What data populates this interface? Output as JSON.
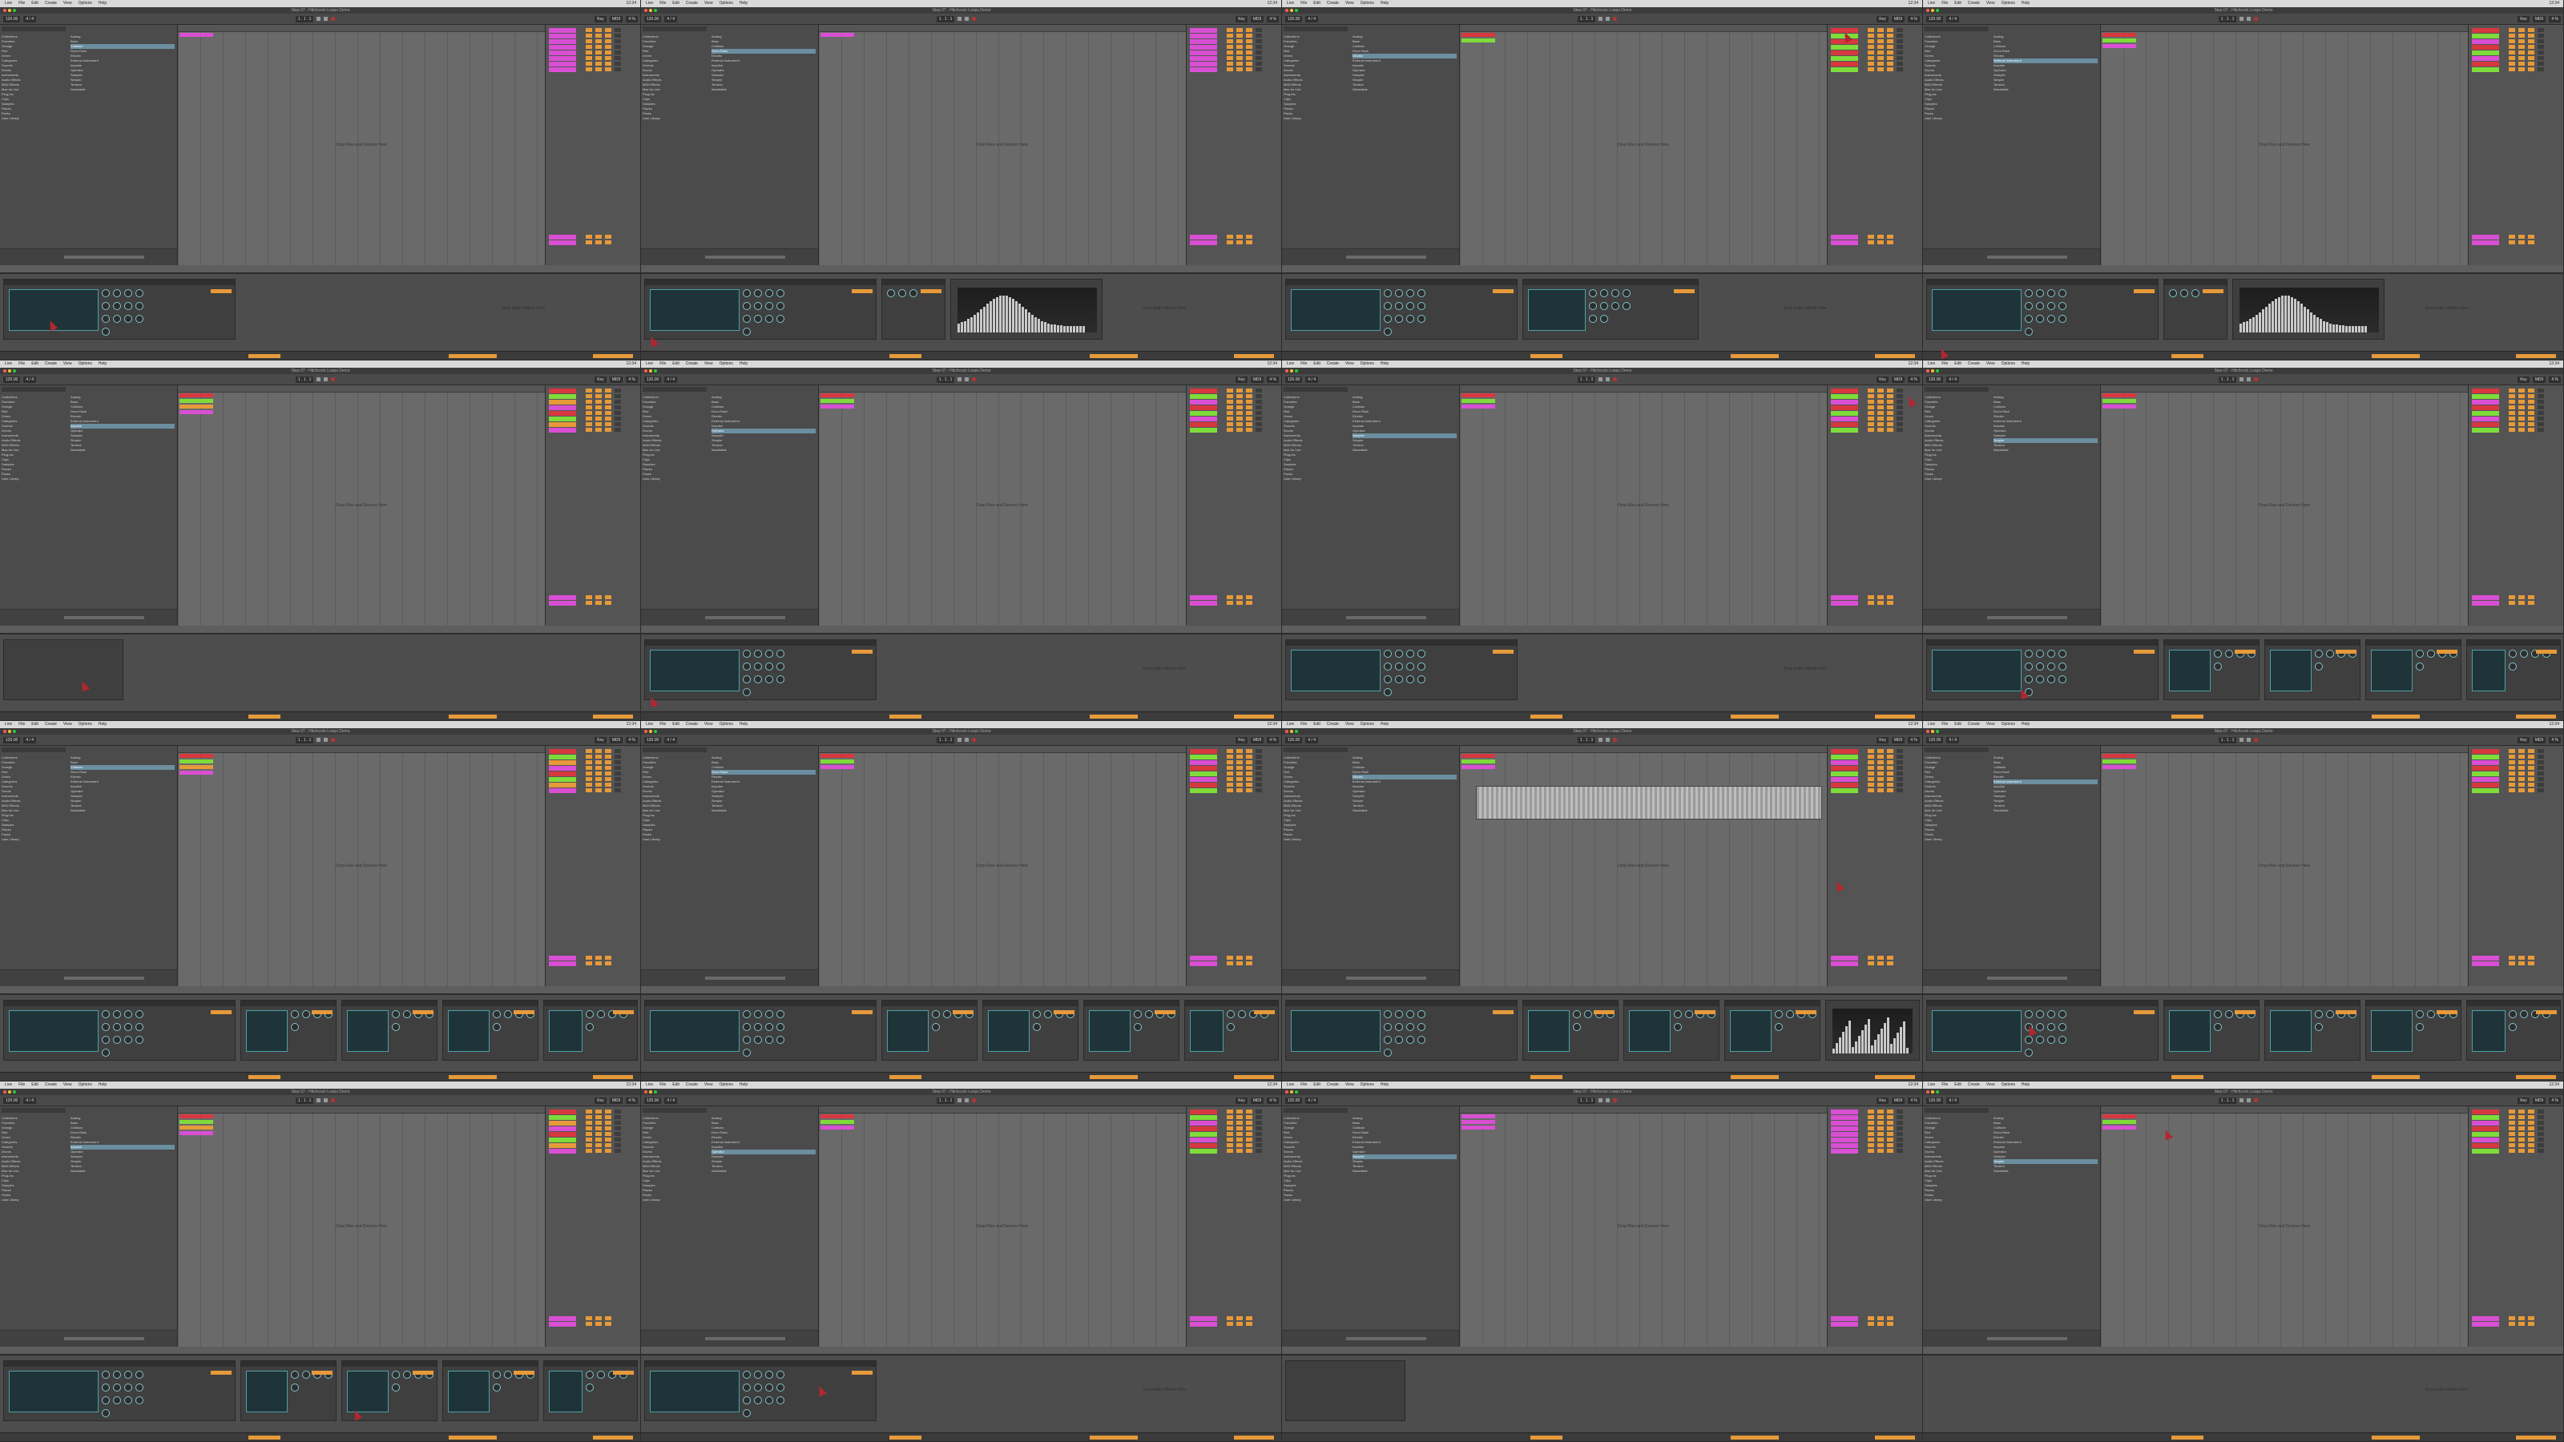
{
  "layout": "4x4 contact sheet of Ableton Live screenshots",
  "app": {
    "window_title": "Step 07 - Hitchcock Loops Demo",
    "menu_items": [
      "Live",
      "File",
      "Edit",
      "Create",
      "View",
      "Options",
      "Help"
    ],
    "clock": "12:34"
  },
  "transport": {
    "tempo": "120.00",
    "time_sig": "4 / 4",
    "position": "1 . 1 . 1",
    "key": "Key",
    "midi": "MIDI",
    "cpu": "4 %"
  },
  "browser": {
    "categories": [
      "Collections",
      "Favorites",
      "Orange",
      "Red",
      "Green",
      "Categories",
      "Sounds",
      "Drums",
      "Instruments",
      "Audio Effects",
      "MIDI Effects",
      "Max for Live",
      "Plug-Ins",
      "Clips",
      "Samples",
      "Places",
      "Packs",
      "User Library"
    ],
    "files": [
      "Analog",
      "Bass",
      "Collision",
      "Drum Rack",
      "Electric",
      "External Instrument",
      "Impulse",
      "Operator",
      "Sampler",
      "Simpler",
      "Tension",
      "Wavetable"
    ]
  },
  "arrangement_hint": "Drop Files and Devices Here",
  "detail_hint": "Drop Audio Effects Here",
  "colors": {
    "accent": "#e69a3a",
    "clip_magenta": "#d94fd3",
    "clip_green": "#7fdb3a",
    "clip_red": "#d7373f",
    "device_cyan": "#4f9ea8"
  },
  "tiles": [
    {
      "clips": [
        "#d94fd3"
      ],
      "detail": "synth"
    },
    {
      "clips": [
        "#d94fd3"
      ],
      "detail": "synth-eq"
    },
    {
      "clips": [
        "#d7373f",
        "#7fdb3a"
      ],
      "detail": "synth-comp"
    },
    {
      "clips": [
        "#d7373f",
        "#7fdb3a",
        "#d94fd3"
      ],
      "detail": "synth-eq"
    },
    {
      "clips": [
        "#d7373f",
        "#7fdb3a",
        "#e69a3a",
        "#d94fd3"
      ],
      "detail": "pianoroll-small"
    },
    {
      "clips": [
        "#d7373f",
        "#7fdb3a",
        "#d94fd3"
      ],
      "detail": "synth"
    },
    {
      "clips": [
        "#d7373f",
        "#7fdb3a",
        "#d94fd3"
      ],
      "detail": "synth"
    },
    {
      "clips": [
        "#d7373f",
        "#7fdb3a",
        "#d94fd3"
      ],
      "detail": "chain"
    },
    {
      "clips": [
        "#d7373f",
        "#7fdb3a",
        "#e69a3a",
        "#d94fd3"
      ],
      "detail": "chain"
    },
    {
      "clips": [
        "#d7373f",
        "#7fdb3a",
        "#d94fd3"
      ],
      "detail": "chain"
    },
    {
      "clips": [
        "#d7373f",
        "#7fdb3a",
        "#d94fd3"
      ],
      "detail": "chain-spec"
    },
    {
      "clips": [
        "#d7373f",
        "#7fdb3a",
        "#d94fd3"
      ],
      "detail": "chain"
    },
    {
      "clips": [
        "#d7373f",
        "#7fdb3a",
        "#e69a3a",
        "#d94fd3"
      ],
      "detail": "chain"
    },
    {
      "clips": [
        "#d7373f",
        "#7fdb3a",
        "#d94fd3"
      ],
      "detail": "synth"
    },
    {
      "clips": [
        "#d94fd3",
        "#d94fd3",
        "#d94fd3"
      ],
      "detail": "pianoroll"
    },
    {
      "clips": [
        "#d7373f",
        "#7fdb3a",
        "#d94fd3"
      ],
      "detail": "empty"
    }
  ]
}
